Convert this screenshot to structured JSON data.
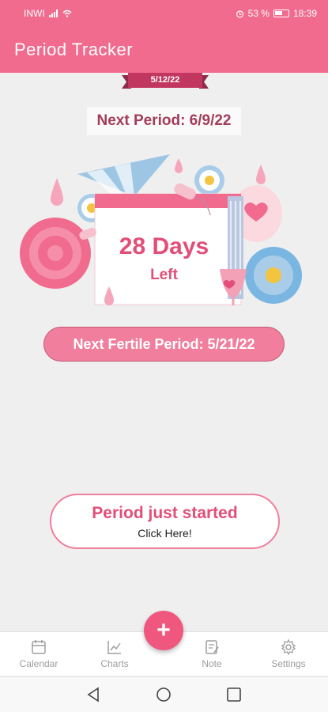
{
  "status_bar": {
    "carrier": "INWI",
    "battery_percent": "53 %",
    "time": "18:39"
  },
  "app_bar": {
    "title": "Period Tracker"
  },
  "today_date": "5/12/22",
  "next_period_text": "Next Period: 6/9/22",
  "countdown": {
    "value": "28 Days",
    "label": "Left"
  },
  "fertile_text": "Next Fertile Period: 5/21/22",
  "start_button": {
    "title": "Period just started",
    "subtitle": "Click Here!"
  },
  "bottom_nav": {
    "items": [
      {
        "label": "Calendar",
        "icon": "calendar-icon"
      },
      {
        "label": "Charts",
        "icon": "chart-icon"
      },
      {
        "label": "Note",
        "icon": "note-icon"
      },
      {
        "label": "Settings",
        "icon": "gear-icon"
      }
    ],
    "fab_icon": "+"
  },
  "colors": {
    "brand": "#f06b8e",
    "accent_text": "#e24e78",
    "dark_accent": "#a23d5b"
  }
}
